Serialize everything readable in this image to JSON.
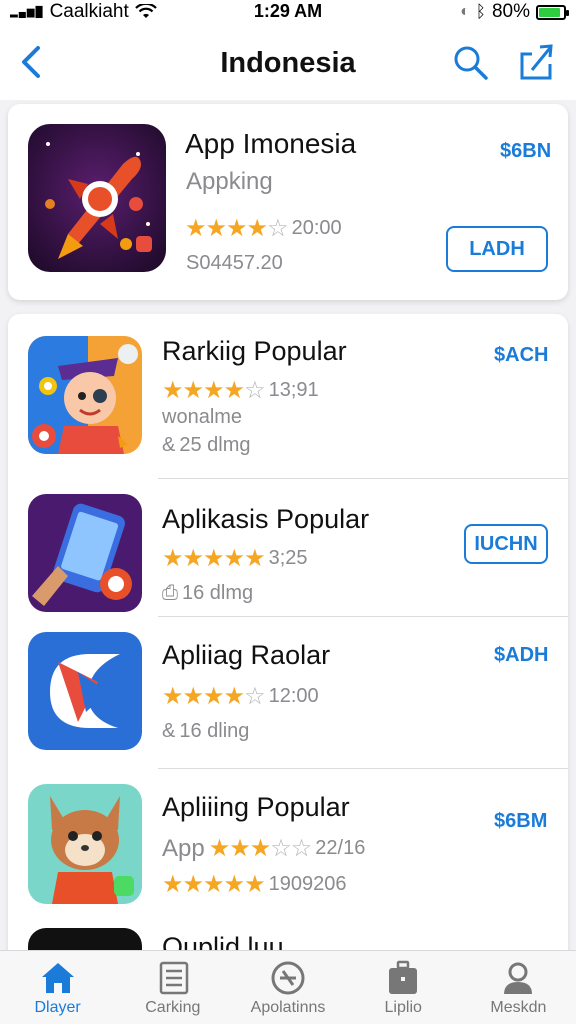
{
  "status_bar": {
    "carrier": "Caalkiaht",
    "time": "1:29 AM",
    "battery": "80%",
    "battery_level": 0.8
  },
  "navbar": {
    "title": "Indonesia",
    "back_icon": "chevron-left-icon",
    "search_icon": "search-icon",
    "share_icon": "share-icon"
  },
  "featured": {
    "name": "App Imonesia",
    "category": "Appking",
    "rating": 4,
    "reviews": "20:00",
    "secondary": "S04457.20",
    "price": "$6BN",
    "button": "LADH"
  },
  "apps": [
    {
      "name": "Rarkiig Popular",
      "rating": 3.5,
      "reviews": "13;91",
      "line2": "wonalme",
      "line3": "25 dlmg",
      "price": "$ACH",
      "button": ""
    },
    {
      "name": "Aplikasis Popular",
      "rating": 4.5,
      "reviews": "3;25",
      "line2": "",
      "line3": "16 dlmg",
      "price": "",
      "button": "IUCHN"
    },
    {
      "name": "Apliiag Raolar",
      "rating": 4,
      "reviews": "12:00",
      "line2": "",
      "line3": "16 dling",
      "price": "$ADH",
      "button": ""
    },
    {
      "name": "Apliiing Popular",
      "rating": 2.5,
      "reviews": "22/16",
      "line2": "App",
      "rating2": 4.5,
      "reviews2": "1909206",
      "price": "$6BM",
      "button": ""
    },
    {
      "name": "Ouplid luu",
      "rating": 0,
      "reviews": "",
      "line2": "",
      "line3": "",
      "price": "",
      "button": ""
    }
  ],
  "tabs": [
    {
      "label": "Dlayer",
      "icon": "home-icon",
      "active": true
    },
    {
      "label": "Carking",
      "icon": "list-icon",
      "active": false
    },
    {
      "label": "Apolatinns",
      "icon": "apps-icon",
      "active": false
    },
    {
      "label": "Liplio",
      "icon": "briefcase-icon",
      "active": false
    },
    {
      "label": "Meskdn",
      "icon": "person-icon",
      "active": false
    }
  ],
  "colors": {
    "accent": "#1a7cd8",
    "star": "#f5a623"
  }
}
